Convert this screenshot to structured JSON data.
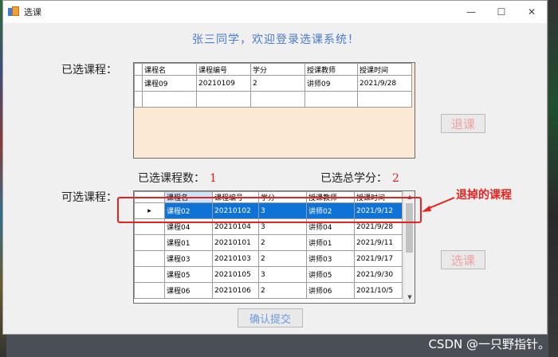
{
  "window": {
    "title": "选课",
    "minimize": "—",
    "maximize": "☐",
    "close": "✕"
  },
  "welcome": "张三同学，欢迎登录选课系统！",
  "selected": {
    "label": "已选课程：",
    "columns": [
      "课程名",
      "课程编号",
      "学分",
      "授课教师",
      "授课时间"
    ],
    "rows": [
      [
        "课程09",
        "20210109",
        "2",
        "讲师09",
        "2021/9/28"
      ],
      [
        "",
        "",
        "",
        "",
        ""
      ]
    ],
    "drop_button": "退课"
  },
  "stats": {
    "count_label": "已选课程数：",
    "count_value": "1",
    "credits_label": "已选总学分：",
    "credits_value": "2"
  },
  "available": {
    "label": "可选课程：",
    "columns": [
      "课程名",
      "课程编号",
      "学分",
      "授课教师",
      "授课时间"
    ],
    "rows": [
      [
        "课程02",
        "20210102",
        "3",
        "讲师02",
        "2021/9/12"
      ],
      [
        "课程04",
        "20210104",
        "3",
        "讲师04",
        "2021/9/28"
      ],
      [
        "课程01",
        "20210101",
        "2",
        "讲师01",
        "2021/9/11"
      ],
      [
        "课程03",
        "20210103",
        "2",
        "讲师03",
        "2021/9/17"
      ],
      [
        "课程05",
        "20210105",
        "3",
        "讲师05",
        "2021/9/30"
      ],
      [
        "课程06",
        "20210106",
        "2",
        "讲师06",
        "2021/10/5"
      ]
    ],
    "select_button": "选课",
    "row_indicator": "▸",
    "scroll_up": "▲",
    "scroll_down": "▼"
  },
  "confirm_button": "确认提交",
  "annotation": "退掉的课程",
  "watermark": "CSDN @一只野指针。",
  "colors": {
    "accent_blue": "#4a7bd0",
    "selection": "#0f72d6",
    "annotation_red": "#e8231f",
    "grid_background": "#fbe9d6"
  }
}
